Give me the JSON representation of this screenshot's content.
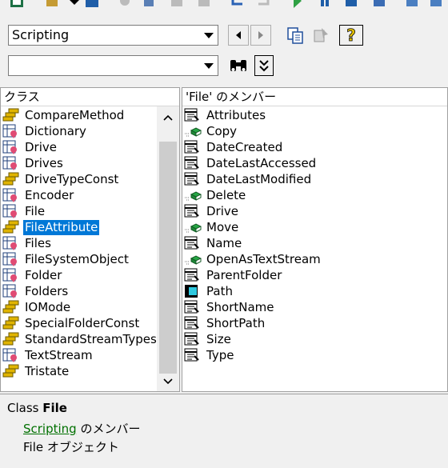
{
  "library_combo": {
    "value": "Scripting"
  },
  "search_combo": {
    "value": ""
  },
  "classes_pane": {
    "header": "クラス",
    "selected_index": 7,
    "items": [
      {
        "label": "CompareMethod",
        "icon": "enum-icon"
      },
      {
        "label": "Dictionary",
        "icon": "class-icon"
      },
      {
        "label": "Drive",
        "icon": "class-icon"
      },
      {
        "label": "Drives",
        "icon": "class-icon"
      },
      {
        "label": "DriveTypeConst",
        "icon": "enum-icon"
      },
      {
        "label": "Encoder",
        "icon": "class-icon"
      },
      {
        "label": "File",
        "icon": "class-icon"
      },
      {
        "label": "FileAttribute",
        "icon": "enum-icon"
      },
      {
        "label": "Files",
        "icon": "class-icon"
      },
      {
        "label": "FileSystemObject",
        "icon": "class-icon"
      },
      {
        "label": "Folder",
        "icon": "class-icon"
      },
      {
        "label": "Folders",
        "icon": "class-icon"
      },
      {
        "label": "IOMode",
        "icon": "enum-icon"
      },
      {
        "label": "SpecialFolderConst",
        "icon": "enum-icon"
      },
      {
        "label": "StandardStreamTypes",
        "icon": "enum-icon"
      },
      {
        "label": "TextStream",
        "icon": "class-icon"
      },
      {
        "label": "Tristate",
        "icon": "enum-icon"
      }
    ]
  },
  "members_pane": {
    "header": "'File' のメンバー",
    "items": [
      {
        "label": "Attributes",
        "icon": "property-icon"
      },
      {
        "label": "Copy",
        "icon": "method-icon"
      },
      {
        "label": "DateCreated",
        "icon": "property-icon"
      },
      {
        "label": "DateLastAccessed",
        "icon": "property-icon"
      },
      {
        "label": "DateLastModified",
        "icon": "property-icon"
      },
      {
        "label": "Delete",
        "icon": "method-icon"
      },
      {
        "label": "Drive",
        "icon": "property-icon"
      },
      {
        "label": "Move",
        "icon": "method-icon"
      },
      {
        "label": "Name",
        "icon": "property-icon"
      },
      {
        "label": "OpenAsTextStream",
        "icon": "method-icon"
      },
      {
        "label": "ParentFolder",
        "icon": "property-icon"
      },
      {
        "label": "Path",
        "icon": "default-property-icon"
      },
      {
        "label": "ShortName",
        "icon": "property-icon"
      },
      {
        "label": "ShortPath",
        "icon": "property-icon"
      },
      {
        "label": "Size",
        "icon": "property-icon"
      },
      {
        "label": "Type",
        "icon": "property-icon"
      }
    ]
  },
  "details": {
    "kind": "Class",
    "name": "File",
    "library_link": "Scripting",
    "member_of": "のメンバー",
    "description": "File オブジェクト"
  },
  "colors": {
    "selection": "#0078d7",
    "link": "#007000"
  }
}
